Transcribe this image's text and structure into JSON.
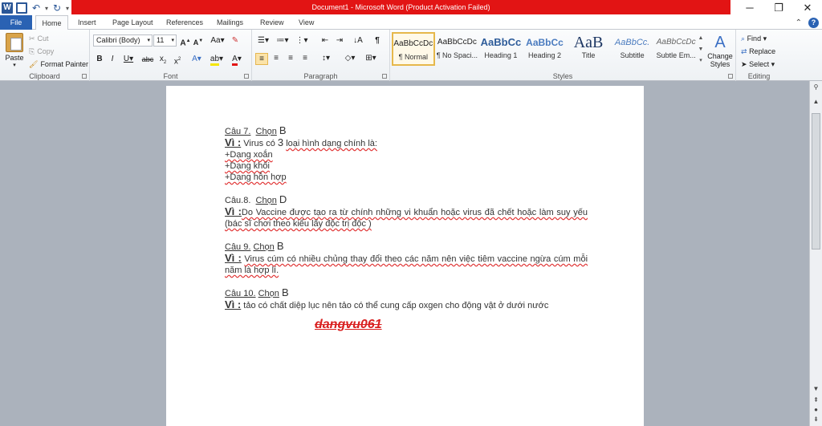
{
  "titlebar": {
    "title": "Document1 - Microsoft Word (Product Activation Failed)",
    "word_logo": "W"
  },
  "tabs": [
    "File",
    "Home",
    "Insert",
    "Page Layout",
    "References",
    "Mailings",
    "Review",
    "View"
  ],
  "clipboard": {
    "paste": "Paste",
    "cut": "Cut",
    "copy": "Copy",
    "format_painter": "Format Painter",
    "group_label": "Clipboard"
  },
  "font": {
    "family": "Calibri (Body)",
    "size": "11",
    "group_label": "Font"
  },
  "paragraph": {
    "group_label": "Paragraph"
  },
  "styles": {
    "group_label": "Styles",
    "items": [
      {
        "preview": "AaBbCcDc",
        "name": "¶ Normal"
      },
      {
        "preview": "AaBbCcDc",
        "name": "¶ No Spaci..."
      },
      {
        "preview": "AaBbCc",
        "name": "Heading 1"
      },
      {
        "preview": "AaBbCc",
        "name": "Heading 2"
      },
      {
        "preview": "AaB",
        "name": "Title"
      },
      {
        "preview": "AaBbCc.",
        "name": "Subtitle"
      },
      {
        "preview": "AaBbCcDc",
        "name": "Subtle Em..."
      }
    ],
    "change_styles_1": "Change",
    "change_styles_2": "Styles"
  },
  "editing": {
    "group_label": "Editing",
    "find": "Find",
    "replace": "Replace",
    "select": "Select"
  },
  "document": {
    "q7_label": "Câu 7.",
    "q7_chon": "Chọn",
    "q7_ans": "B",
    "q7_vi": "Vì :",
    "q7_text_a": "Virus có",
    "q7_num": "3",
    "q7_text_b": "loại hình dạng chính là:",
    "q7_l1": "+Dạng xoắn",
    "q7_l2": "+Dạng khối",
    "q7_l3": "+Dạng hỗn hợp",
    "q8_label": "Câu.8.",
    "q8_chon": "Chọn",
    "q8_ans": "D",
    "q8_vi": "Vì :",
    "q8_text": "Do Vaccine được tạo ra từ chính những vi khuẩn hoặc virus đã chết hoặc làm suy yếu (bác sĩ chơi theo kiểu lấy độc trị độc )",
    "q9_label": "Câu 9.",
    "q9_chon": "Chọn",
    "q9_ans": "B",
    "q9_vi": "Vì :",
    "q9_text": "Virus cúm có nhiều chủng thay đổi theo các năm nên việc tiêm vaccine ngừa cúm mỗi năm là hợp lí.",
    "q10_label": "Câu 10.",
    "q10_chon": "Chọn",
    "q10_ans": "B",
    "q10_vi": "Vì :",
    "q10_text": "tảo có chất diệp lục nên tảo có thể cung cấp oxgen cho động vật ở dưới nước",
    "watermark": "dangvu061"
  }
}
